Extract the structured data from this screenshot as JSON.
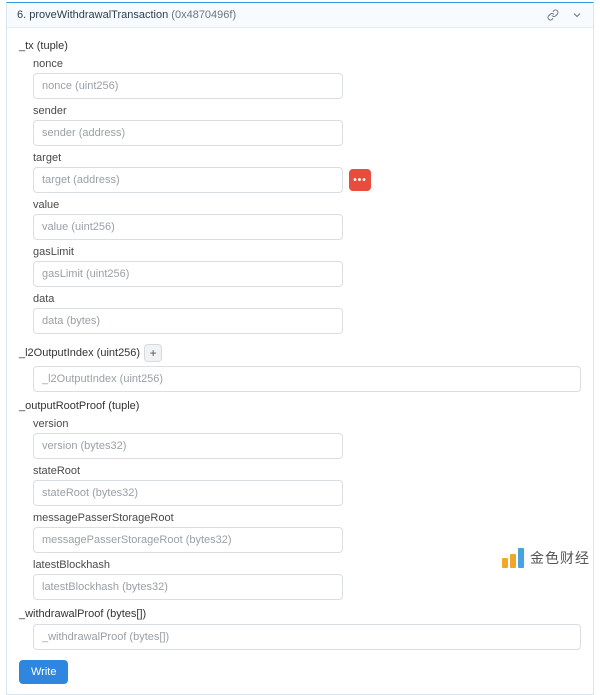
{
  "header": {
    "index": "6.",
    "name": "proveWithdrawalTransaction",
    "hash": "(0x4870496f)"
  },
  "sections": {
    "tx": {
      "label": "_tx (tuple)",
      "fields": {
        "nonce": {
          "label": "nonce",
          "placeholder": "nonce (uint256)"
        },
        "sender": {
          "label": "sender",
          "placeholder": "sender (address)"
        },
        "target": {
          "label": "target",
          "placeholder": "target (address)"
        },
        "value": {
          "label": "value",
          "placeholder": "value (uint256)"
        },
        "gasLimit": {
          "label": "gasLimit",
          "placeholder": "gasLimit (uint256)"
        },
        "data": {
          "label": "data",
          "placeholder": "data (bytes)"
        }
      }
    },
    "l2OutputIndex": {
      "label": "_l2OutputIndex (uint256)",
      "placeholder": "_l2OutputIndex (uint256)"
    },
    "outputRootProof": {
      "label": "_outputRootProof (tuple)",
      "fields": {
        "version": {
          "label": "version",
          "placeholder": "version (bytes32)"
        },
        "stateRoot": {
          "label": "stateRoot",
          "placeholder": "stateRoot (bytes32)"
        },
        "messagePasserStorageRoot": {
          "label": "messagePasserStorageRoot",
          "placeholder": "messagePasserStorageRoot (bytes32)"
        },
        "latestBlockhash": {
          "label": "latestBlockhash",
          "placeholder": "latestBlockhash (bytes32)"
        }
      }
    },
    "withdrawalProof": {
      "label": "_withdrawalProof (bytes[])",
      "placeholder": "_withdrawalProof (bytes[])"
    }
  },
  "actions": {
    "write": "Write",
    "walletBadge": "•••",
    "plus": "+"
  },
  "watermark": "金色财经"
}
